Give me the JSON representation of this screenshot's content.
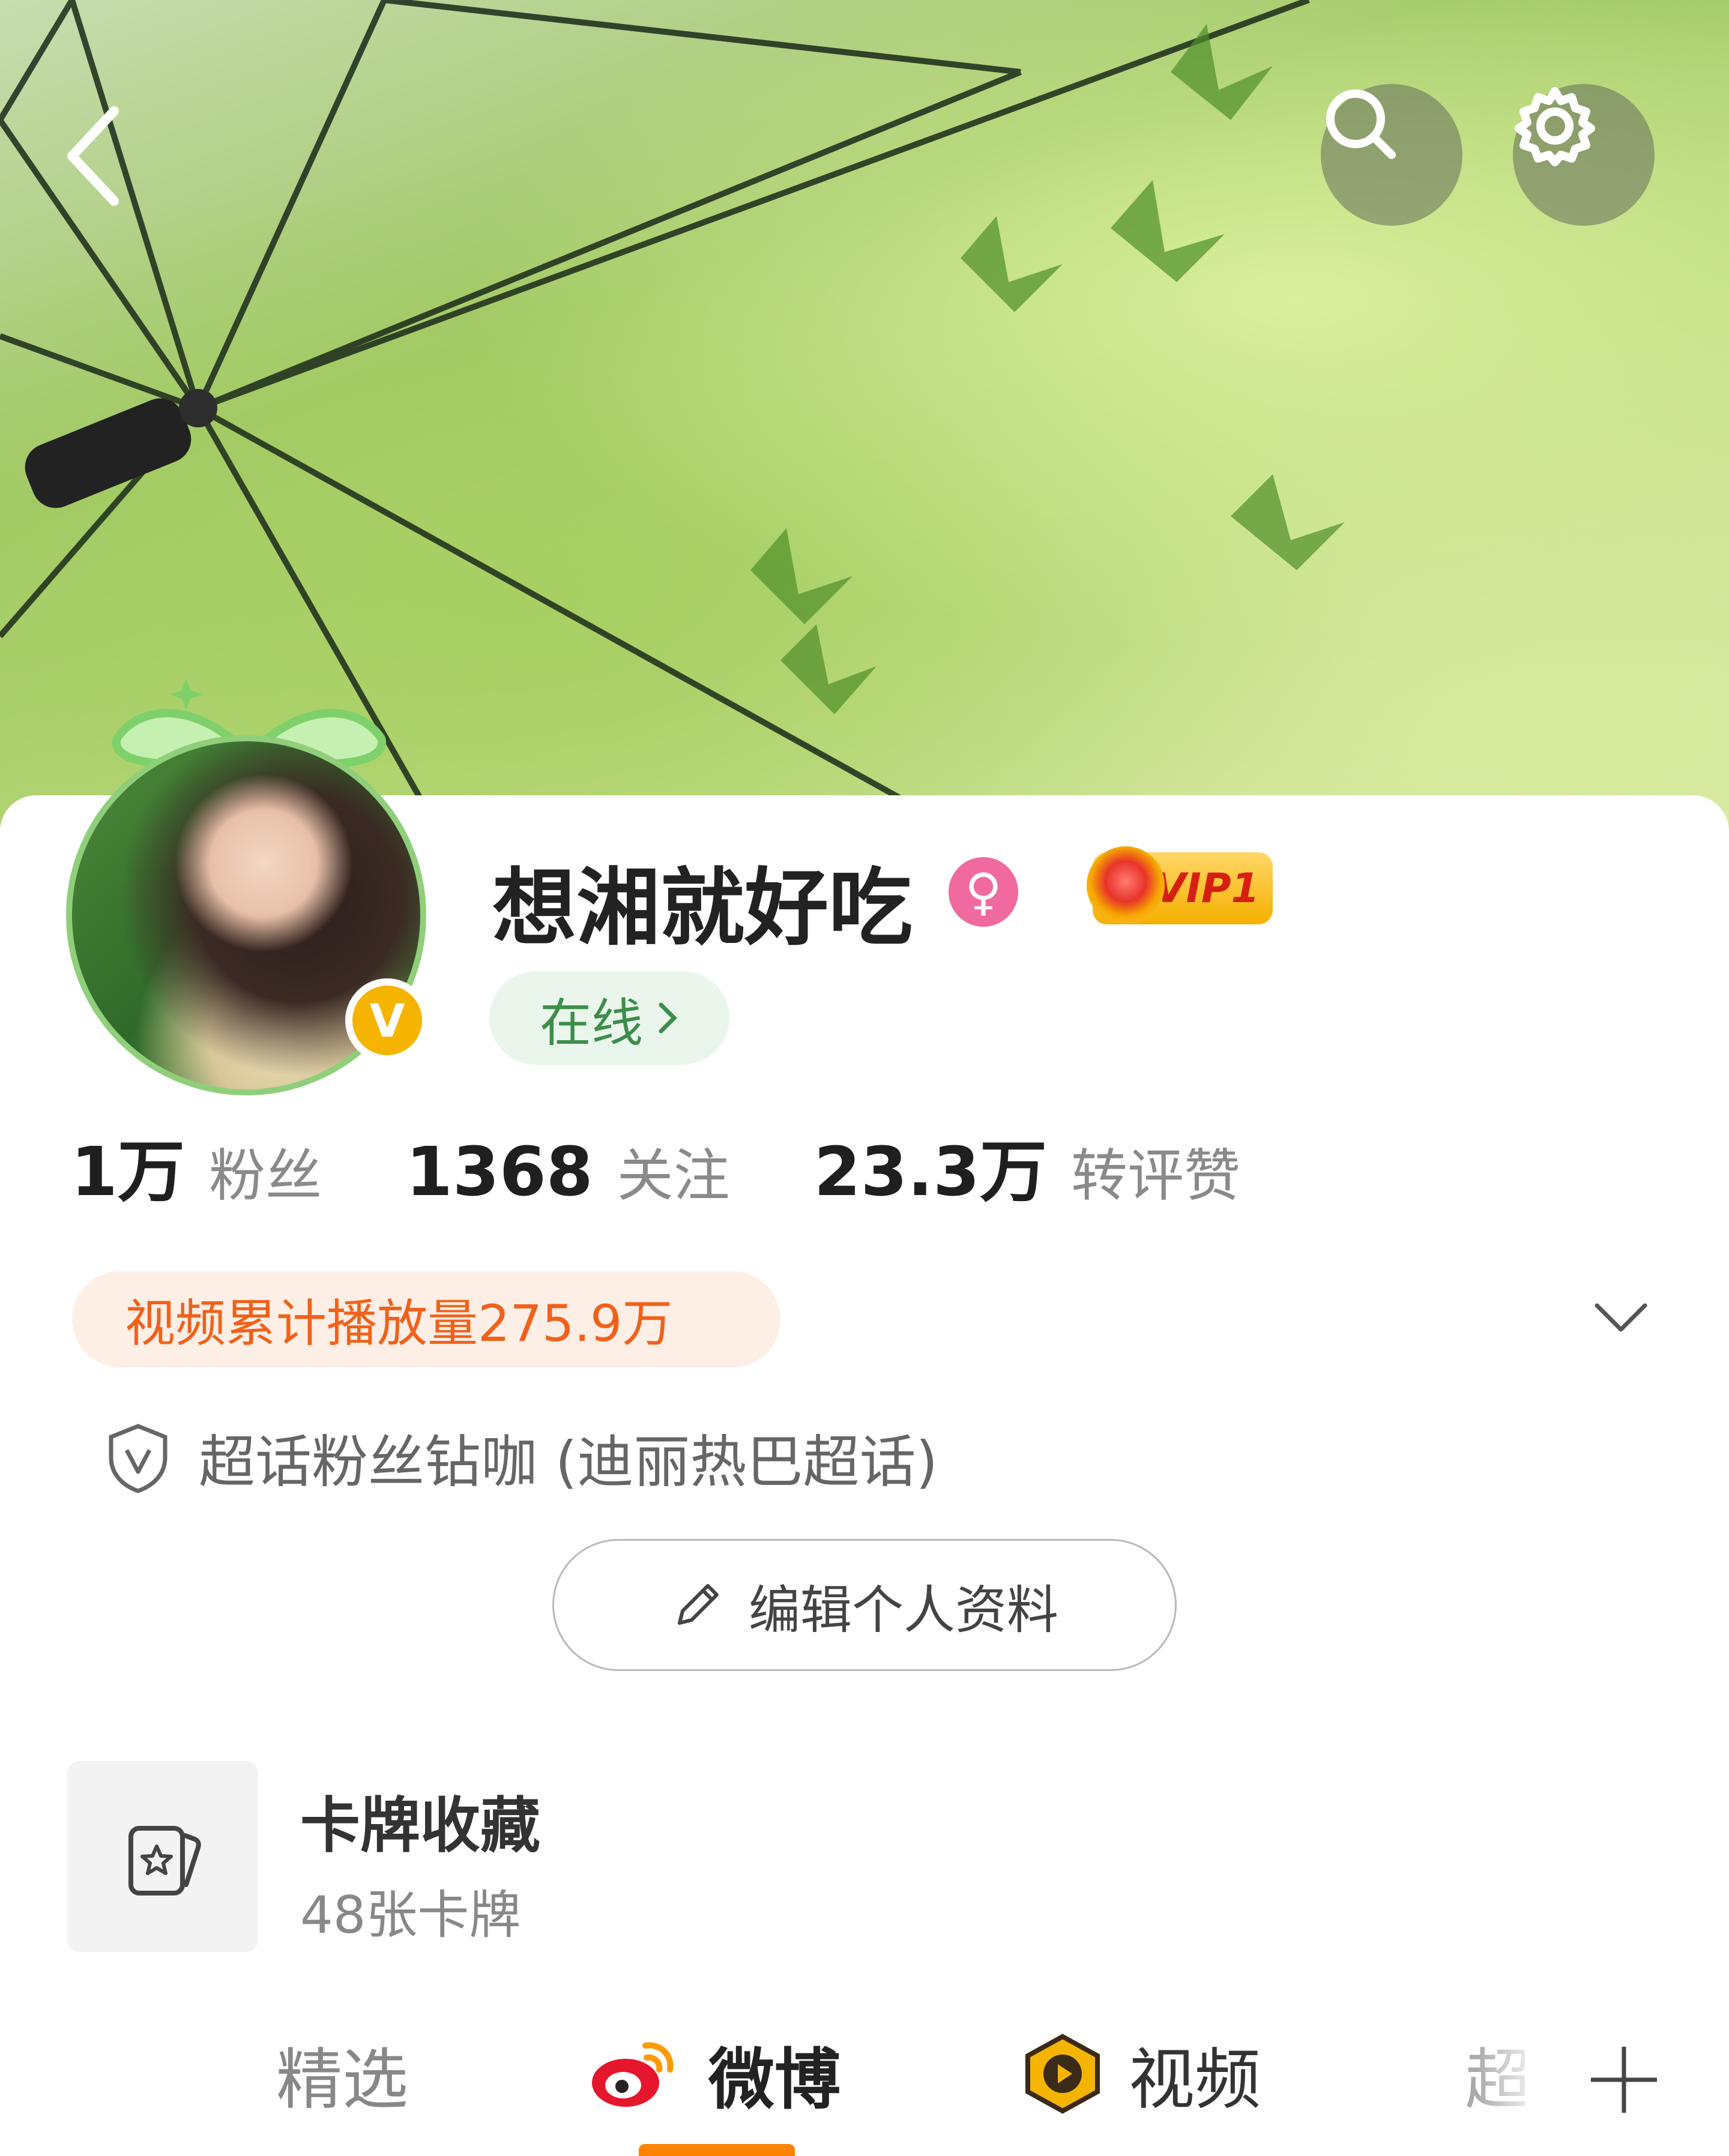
{
  "header": {
    "back_icon": "chevron-left-icon",
    "search_icon": "search-icon",
    "settings_icon": "gear-icon"
  },
  "profile": {
    "username": "想湘就好吃",
    "gender_icon": "female-icon",
    "verified_icon": "v-verified-icon",
    "vip_label": "VIP1",
    "online_label": "在线"
  },
  "stats": [
    {
      "value": "1万",
      "label": "粉丝"
    },
    {
      "value": "1368",
      "label": "关注"
    },
    {
      "value": "23.3万",
      "label": "转评赞"
    }
  ],
  "video_plays": "视频累计播放量275.9万",
  "fan_title": "超话粉丝钻咖 (迪丽热巴超话)",
  "edit_profile": "编辑个人资料",
  "cards": {
    "title": "卡牌收藏",
    "subtitle": "48张卡牌"
  },
  "tabs": {
    "selected": "精选",
    "weibo": "微博",
    "video": "视频",
    "super": "超"
  },
  "colors": {
    "accent": "#ff8200",
    "online_green": "#3c8e4a",
    "play_orange": "#f0621a",
    "vip_gold": "#f6b000"
  }
}
